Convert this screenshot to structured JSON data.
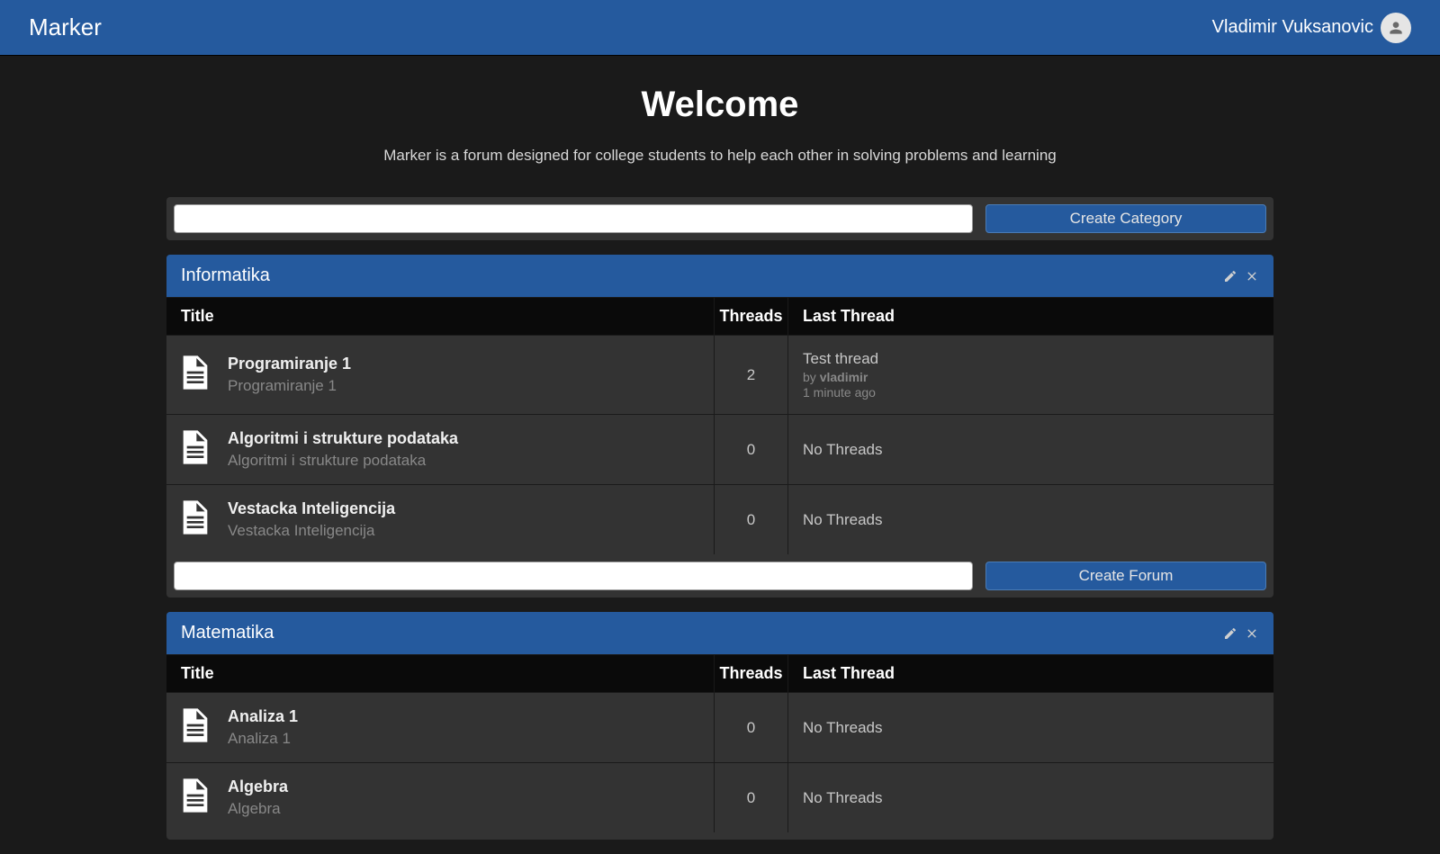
{
  "header": {
    "app_name": "Marker",
    "user_name": "Vladimir Vuksanovic"
  },
  "welcome": {
    "title": "Welcome",
    "subtitle": "Marker is a forum designed for college students to help each other in solving problems and learning"
  },
  "create_category": {
    "button_label": "Create Category"
  },
  "columns": {
    "title": "Title",
    "threads": "Threads",
    "last_thread": "Last Thread"
  },
  "create_forum_label": "Create Forum",
  "categories": [
    {
      "name": "Informatika",
      "forums": [
        {
          "name": "Programiranje 1",
          "description": "Programiranje 1",
          "threads": "2",
          "last_thread": {
            "title": "Test thread",
            "by_label": "by ",
            "author": "vladimir",
            "time": "1 minute ago"
          }
        },
        {
          "name": "Algoritmi i strukture podataka",
          "description": "Algoritmi i strukture podataka",
          "threads": "0",
          "no_threads": "No Threads"
        },
        {
          "name": "Vestacka Inteligencija",
          "description": "Vestacka Inteligencija",
          "threads": "0",
          "no_threads": "No Threads"
        }
      ]
    },
    {
      "name": "Matematika",
      "forums": [
        {
          "name": "Analiza 1",
          "description": "Analiza 1",
          "threads": "0",
          "no_threads": "No Threads"
        },
        {
          "name": "Algebra",
          "description": "Algebra",
          "threads": "0",
          "no_threads": "No Threads"
        }
      ]
    }
  ]
}
